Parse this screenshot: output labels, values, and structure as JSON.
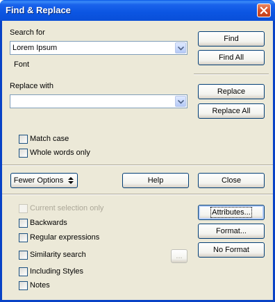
{
  "window": {
    "title": "Find & Replace",
    "close_icon": "close-icon"
  },
  "search": {
    "label": "Search for",
    "value": "Lorem Ipsum",
    "attribute_note": "Font"
  },
  "replace": {
    "label": "Replace with",
    "value": ""
  },
  "buttons": {
    "find": "Find",
    "find_all": "Find All",
    "replace": "Replace",
    "replace_all": "Replace All",
    "fewer_options": "Fewer Options",
    "help": "Help",
    "close": "Close",
    "attributes": "Attributes...",
    "format": "Format...",
    "no_format": "No Format",
    "similarity_settings": "..."
  },
  "options": {
    "match_case": {
      "label": "Match case",
      "checked": false
    },
    "whole_words": {
      "label": "Whole words only",
      "checked": false
    },
    "current_selection": {
      "label": "Current selection only",
      "checked": false,
      "disabled": true
    },
    "backwards": {
      "label": "Backwards",
      "checked": false
    },
    "regex": {
      "label": "Regular expressions",
      "checked": false
    },
    "similarity": {
      "label": "Similarity search",
      "checked": false
    },
    "styles": {
      "label": "Including Styles",
      "checked": false
    },
    "notes": {
      "label": "Notes",
      "checked": false
    }
  },
  "colors": {
    "titlebar": "#0a55e0",
    "dialog_bg": "#ece9d8",
    "close_button": "#d6502a",
    "disabled_text": "#aca899"
  }
}
